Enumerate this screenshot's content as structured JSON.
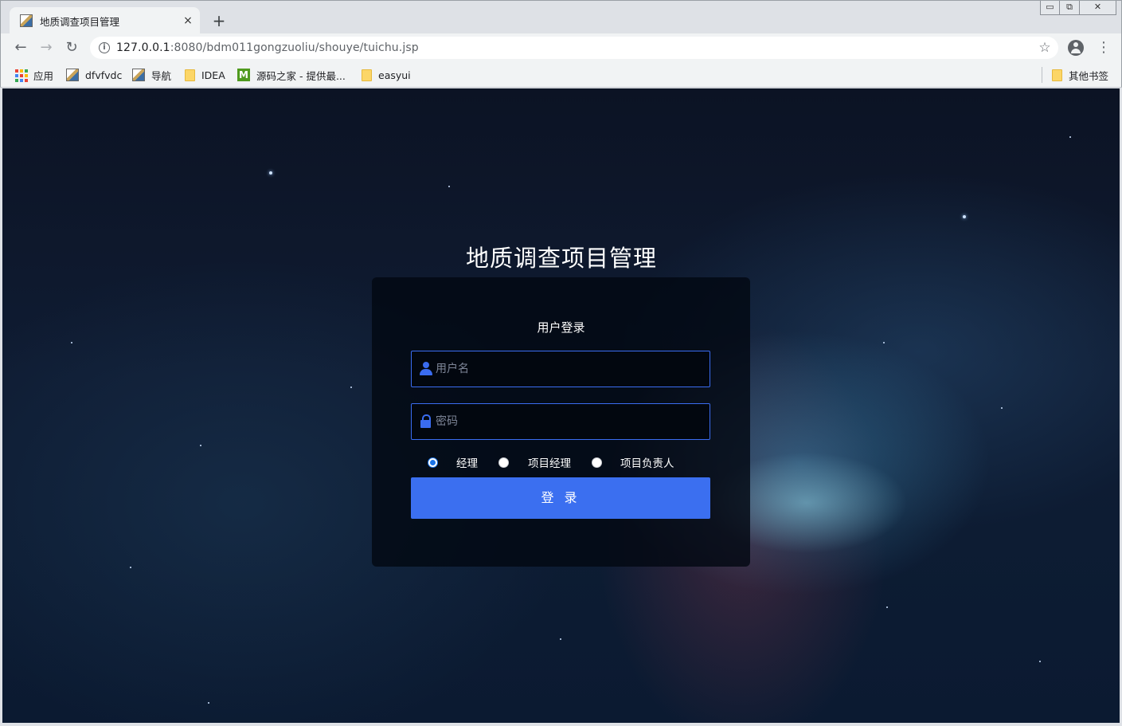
{
  "browser": {
    "tab_title": "地质调查项目管理",
    "tab_close": "×",
    "new_tab": "+",
    "window_controls": {
      "minimize": "▭",
      "restore": "⧉",
      "close": "✕"
    },
    "url_host": "127.0.0.1",
    "url_rest": ":8080/bdm011gongzuoliu/shouye/tuichu.jsp",
    "bookmarks": [
      {
        "label": "应用",
        "icon": "apps-grid-icon"
      },
      {
        "label": "dfvfvdc",
        "icon": "image-favicon-icon"
      },
      {
        "label": "导航",
        "icon": "image-favicon-icon"
      },
      {
        "label": "IDEA",
        "icon": "folder-icon"
      },
      {
        "label": "源码之家 - 提供最...",
        "icon": "m-favicon-icon"
      },
      {
        "label": "easyui",
        "icon": "folder-icon"
      }
    ],
    "other_bookmarks": "其他书签"
  },
  "page": {
    "app_title": "地质调查项目管理",
    "login_heading": "用户登录",
    "username_placeholder": "用户名",
    "username_value": "",
    "password_placeholder": "密码",
    "password_value": "",
    "roles": [
      {
        "label": "经理",
        "checked": true
      },
      {
        "label": "项目经理",
        "checked": false
      },
      {
        "label": "项目负责人",
        "checked": false
      }
    ],
    "login_button": "登 录",
    "accent_color": "#3b6ff0"
  }
}
